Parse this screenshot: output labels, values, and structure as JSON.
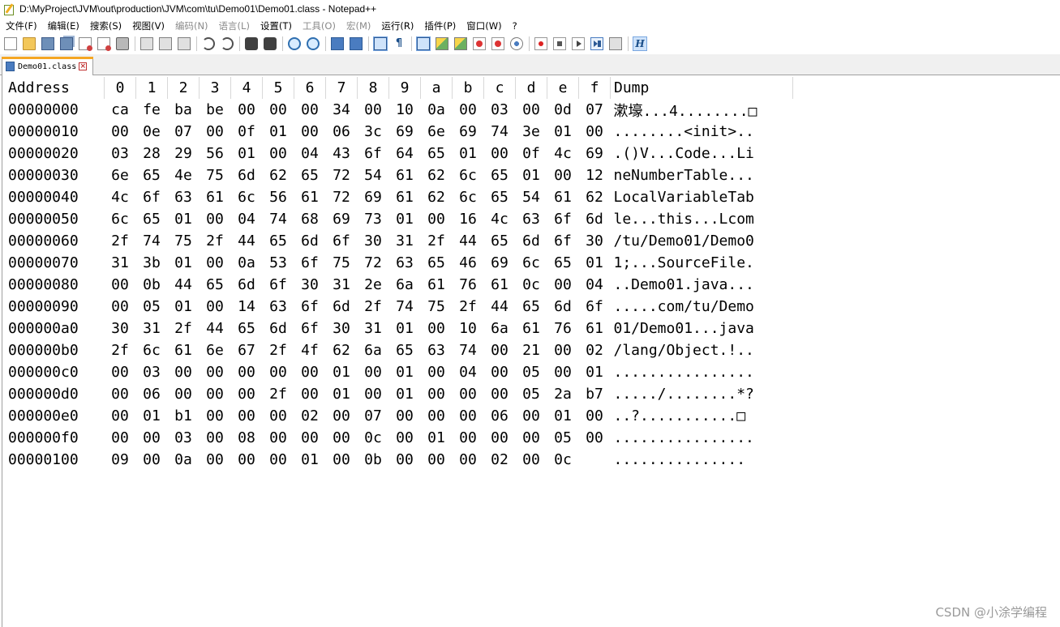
{
  "window": {
    "title": "D:\\MyProject\\JVM\\out\\production\\JVM\\com\\tu\\Demo01\\Demo01.class - Notepad++"
  },
  "menu": [
    {
      "label": "文件(F)",
      "enabled": true
    },
    {
      "label": "编辑(E)",
      "enabled": true
    },
    {
      "label": "搜索(S)",
      "enabled": true
    },
    {
      "label": "视图(V)",
      "enabled": true
    },
    {
      "label": "编码(N)",
      "enabled": false
    },
    {
      "label": "语言(L)",
      "enabled": false
    },
    {
      "label": "设置(T)",
      "enabled": true
    },
    {
      "label": "工具(O)",
      "enabled": false
    },
    {
      "label": "宏(M)",
      "enabled": false
    },
    {
      "label": "运行(R)",
      "enabled": true
    },
    {
      "label": "插件(P)",
      "enabled": true
    },
    {
      "label": "窗口(W)",
      "enabled": true
    },
    {
      "label": "?",
      "enabled": true
    }
  ],
  "toolbar_icons": [
    "new-file-icon",
    "open-file-icon",
    "save-icon",
    "save-all-icon",
    "close-icon",
    "close-all-icon",
    "print-icon",
    "sep",
    "cut-icon",
    "copy-icon",
    "paste-icon",
    "sep",
    "undo-icon",
    "redo-icon",
    "sep",
    "find-icon",
    "replace-icon",
    "sep",
    "zoom-in-icon",
    "zoom-out-icon",
    "sep",
    "sync-vertical-icon",
    "sync-horizontal-icon",
    "sep",
    "word-wrap-icon",
    "show-all-chars-icon",
    "sep",
    "indent-guide-icon",
    "doc-map-icon",
    "function-list-icon",
    "folder-workspace-icon",
    "doc-monitor-icon",
    "preview-icon",
    "sep",
    "macro-record-icon",
    "macro-stop-icon",
    "macro-play-icon",
    "macro-run-multiple-icon",
    "macro-save-icon",
    "sep",
    "hex-editor-icon"
  ],
  "tabs": [
    {
      "label": "Demo01.class",
      "active": true
    }
  ],
  "hex": {
    "header": {
      "address": "Address",
      "cols": [
        "0",
        "1",
        "2",
        "3",
        "4",
        "5",
        "6",
        "7",
        "8",
        "9",
        "a",
        "b",
        "c",
        "d",
        "e",
        "f"
      ],
      "dump": "Dump"
    },
    "rows": [
      {
        "addr": "00000000",
        "bytes": [
          "ca",
          "fe",
          "ba",
          "be",
          "00",
          "00",
          "00",
          "34",
          "00",
          "10",
          "0a",
          "00",
          "03",
          "00",
          "0d",
          "07"
        ],
        "dump": "漱壕...4........□"
      },
      {
        "addr": "00000010",
        "bytes": [
          "00",
          "0e",
          "07",
          "00",
          "0f",
          "01",
          "00",
          "06",
          "3c",
          "69",
          "6e",
          "69",
          "74",
          "3e",
          "01",
          "00"
        ],
        "dump": "........<init>.."
      },
      {
        "addr": "00000020",
        "bytes": [
          "03",
          "28",
          "29",
          "56",
          "01",
          "00",
          "04",
          "43",
          "6f",
          "64",
          "65",
          "01",
          "00",
          "0f",
          "4c",
          "69"
        ],
        "dump": ".()V...Code...Li"
      },
      {
        "addr": "00000030",
        "bytes": [
          "6e",
          "65",
          "4e",
          "75",
          "6d",
          "62",
          "65",
          "72",
          "54",
          "61",
          "62",
          "6c",
          "65",
          "01",
          "00",
          "12"
        ],
        "dump": "neNumberTable..."
      },
      {
        "addr": "00000040",
        "bytes": [
          "4c",
          "6f",
          "63",
          "61",
          "6c",
          "56",
          "61",
          "72",
          "69",
          "61",
          "62",
          "6c",
          "65",
          "54",
          "61",
          "62"
        ],
        "dump": "LocalVariableTab"
      },
      {
        "addr": "00000050",
        "bytes": [
          "6c",
          "65",
          "01",
          "00",
          "04",
          "74",
          "68",
          "69",
          "73",
          "01",
          "00",
          "16",
          "4c",
          "63",
          "6f",
          "6d"
        ],
        "dump": "le...this...Lcom"
      },
      {
        "addr": "00000060",
        "bytes": [
          "2f",
          "74",
          "75",
          "2f",
          "44",
          "65",
          "6d",
          "6f",
          "30",
          "31",
          "2f",
          "44",
          "65",
          "6d",
          "6f",
          "30"
        ],
        "dump": "/tu/Demo01/Demo0"
      },
      {
        "addr": "00000070",
        "bytes": [
          "31",
          "3b",
          "01",
          "00",
          "0a",
          "53",
          "6f",
          "75",
          "72",
          "63",
          "65",
          "46",
          "69",
          "6c",
          "65",
          "01"
        ],
        "dump": "1;...SourceFile."
      },
      {
        "addr": "00000080",
        "bytes": [
          "00",
          "0b",
          "44",
          "65",
          "6d",
          "6f",
          "30",
          "31",
          "2e",
          "6a",
          "61",
          "76",
          "61",
          "0c",
          "00",
          "04"
        ],
        "dump": "..Demo01.java..."
      },
      {
        "addr": "00000090",
        "bytes": [
          "00",
          "05",
          "01",
          "00",
          "14",
          "63",
          "6f",
          "6d",
          "2f",
          "74",
          "75",
          "2f",
          "44",
          "65",
          "6d",
          "6f"
        ],
        "dump": ".....com/tu/Demo"
      },
      {
        "addr": "000000a0",
        "bytes": [
          "30",
          "31",
          "2f",
          "44",
          "65",
          "6d",
          "6f",
          "30",
          "31",
          "01",
          "00",
          "10",
          "6a",
          "61",
          "76",
          "61"
        ],
        "dump": "01/Demo01...java"
      },
      {
        "addr": "000000b0",
        "bytes": [
          "2f",
          "6c",
          "61",
          "6e",
          "67",
          "2f",
          "4f",
          "62",
          "6a",
          "65",
          "63",
          "74",
          "00",
          "21",
          "00",
          "02"
        ],
        "dump": "/lang/Object.!.."
      },
      {
        "addr": "000000c0",
        "bytes": [
          "00",
          "03",
          "00",
          "00",
          "00",
          "00",
          "00",
          "01",
          "00",
          "01",
          "00",
          "04",
          "00",
          "05",
          "00",
          "01"
        ],
        "dump": "................"
      },
      {
        "addr": "000000d0",
        "bytes": [
          "00",
          "06",
          "00",
          "00",
          "00",
          "2f",
          "00",
          "01",
          "00",
          "01",
          "00",
          "00",
          "00",
          "05",
          "2a",
          "b7"
        ],
        "dump": "...../........*?"
      },
      {
        "addr": "000000e0",
        "bytes": [
          "00",
          "01",
          "b1",
          "00",
          "00",
          "00",
          "02",
          "00",
          "07",
          "00",
          "00",
          "00",
          "06",
          "00",
          "01",
          "00"
        ],
        "dump": "..?...........□"
      },
      {
        "addr": "000000f0",
        "bytes": [
          "00",
          "00",
          "03",
          "00",
          "08",
          "00",
          "00",
          "00",
          "0c",
          "00",
          "01",
          "00",
          "00",
          "00",
          "05",
          "00"
        ],
        "dump": "................"
      },
      {
        "addr": "00000100",
        "bytes": [
          "09",
          "00",
          "0a",
          "00",
          "00",
          "00",
          "01",
          "00",
          "0b",
          "00",
          "00",
          "00",
          "02",
          "00",
          "0c",
          ""
        ],
        "dump": "..............."
      }
    ]
  },
  "watermark": "CSDN @小涂学编程"
}
